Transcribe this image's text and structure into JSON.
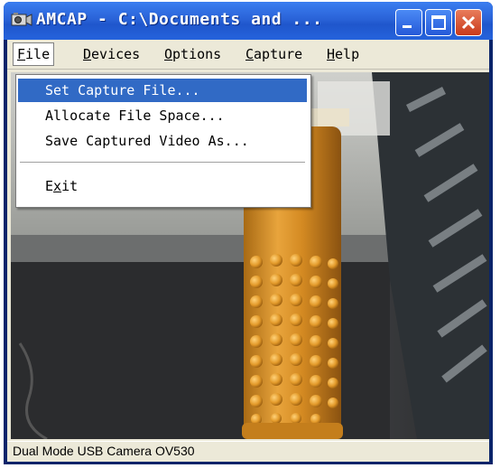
{
  "window": {
    "title": "AMCAP - C:\\Documents and ...",
    "app_icon": "camera-icon"
  },
  "title_buttons": {
    "minimize_icon": "minimize-icon",
    "maximize_icon": "maximize-icon",
    "close_icon": "close-icon"
  },
  "menu": {
    "items": [
      {
        "label": "File",
        "mnemonic": "F",
        "rest": "ile"
      },
      {
        "label": "Devices",
        "mnemonic": "D",
        "rest": "evices"
      },
      {
        "label": "Options",
        "mnemonic": "O",
        "rest": "ptions"
      },
      {
        "label": "Capture",
        "mnemonic": "C",
        "rest": "apture"
      },
      {
        "label": "Help",
        "mnemonic": "H",
        "rest": "elp"
      }
    ]
  },
  "file_menu": {
    "items": [
      {
        "label": "Set Capture File..."
      },
      {
        "label": "Allocate File Space..."
      },
      {
        "label": "Save Captured Video As..."
      },
      {
        "label": "Exit",
        "pre": "E",
        "mnemonic": "x",
        "post": "it"
      }
    ],
    "selected_index": 0
  },
  "status": {
    "text": "Dual Mode USB Camera OV530"
  },
  "colors": {
    "titlebar": "#2a63d8",
    "menu_highlight": "#316ac5",
    "window_face": "#ece9d8"
  }
}
